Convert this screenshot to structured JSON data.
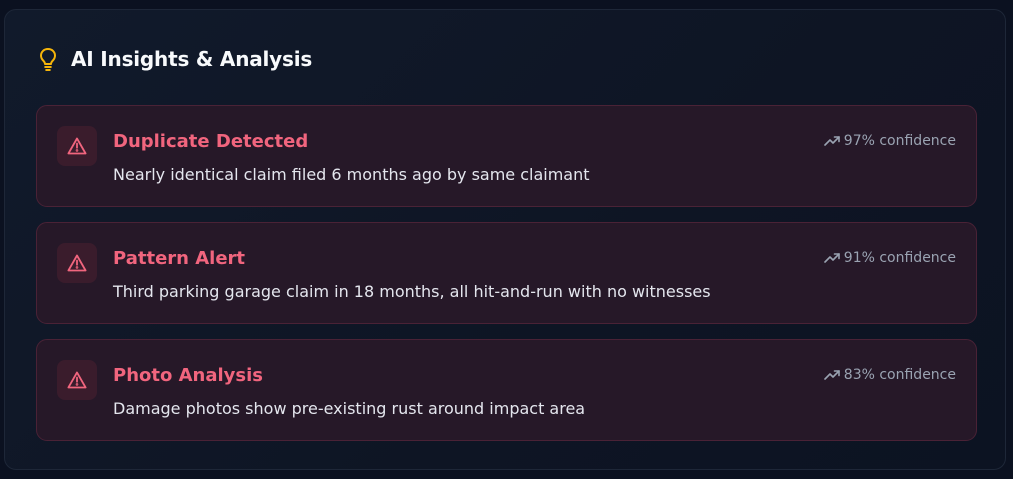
{
  "panel": {
    "title": "AI Insights & Analysis",
    "icon": "lightbulb-icon"
  },
  "insights": [
    {
      "title": "Duplicate Detected",
      "description": "Nearly identical claim filed 6 months ago by same claimant",
      "confidence_label": "97% confidence",
      "confidence": 97,
      "icon": "alert-triangle-icon"
    },
    {
      "title": "Pattern Alert",
      "description": "Third parking garage claim in 18 months, all hit-and-run with no witnesses",
      "confidence_label": "91% confidence",
      "confidence": 91,
      "icon": "alert-triangle-icon"
    },
    {
      "title": "Photo Analysis",
      "description": "Damage photos show pre-existing rust around impact area",
      "confidence_label": "83% confidence",
      "confidence": 83,
      "icon": "alert-triangle-icon"
    }
  ],
  "colors": {
    "accent_alert": "#f1657e",
    "bulb": "#f5b50a",
    "card_bg": "#261828",
    "card_border": "#4a2236",
    "muted_text": "#9aa3b2"
  }
}
